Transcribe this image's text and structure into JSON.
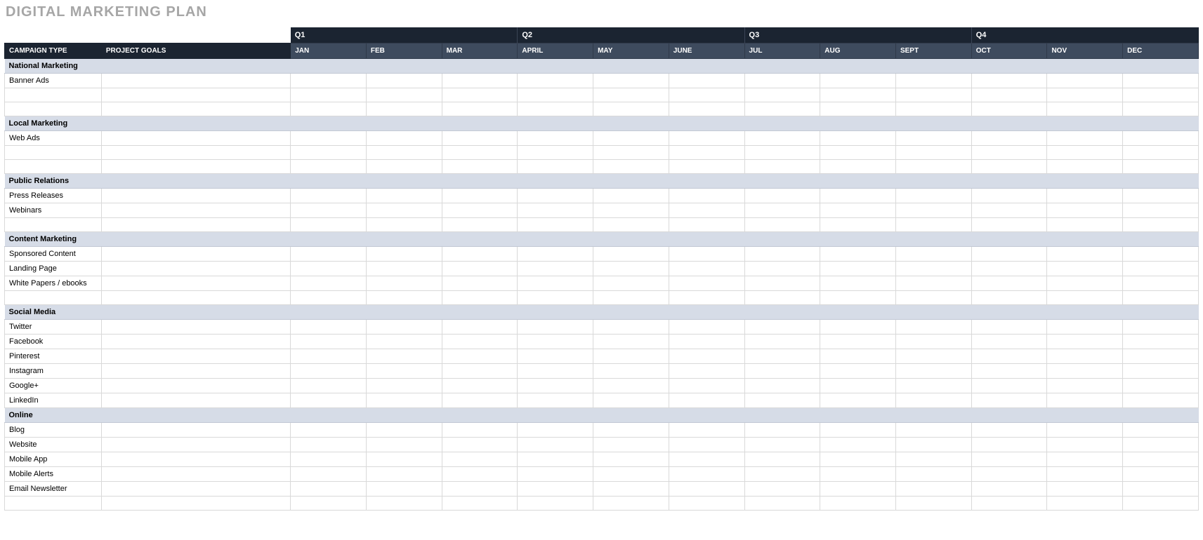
{
  "title": "DIGITAL MARKETING PLAN",
  "columns": {
    "campaign": "CAMPAIGN TYPE",
    "goals": "PROJECT GOALS"
  },
  "quarters": [
    "Q1",
    "Q2",
    "Q3",
    "Q4"
  ],
  "months": [
    "JAN",
    "FEB",
    "MAR",
    "APRIL",
    "MAY",
    "JUNE",
    "JUL",
    "AUG",
    "SEPT",
    "OCT",
    "NOV",
    "DEC"
  ],
  "sections": [
    {
      "name": "National Marketing",
      "rows": [
        "Banner Ads",
        "",
        ""
      ]
    },
    {
      "name": "Local Marketing",
      "rows": [
        "Web Ads",
        "",
        ""
      ]
    },
    {
      "name": "Public Relations",
      "rows": [
        "Press Releases",
        "Webinars",
        ""
      ]
    },
    {
      "name": "Content Marketing",
      "rows": [
        "Sponsored Content",
        "Landing Page",
        "White Papers / ebooks",
        ""
      ]
    },
    {
      "name": "Social Media",
      "rows": [
        "Twitter",
        "Facebook",
        "Pinterest",
        "Instagram",
        "Google+",
        "LinkedIn"
      ]
    },
    {
      "name": "Online",
      "rows": [
        "Blog",
        "Website",
        "Mobile App",
        "Mobile Alerts",
        "Email Newsletter",
        ""
      ]
    }
  ]
}
